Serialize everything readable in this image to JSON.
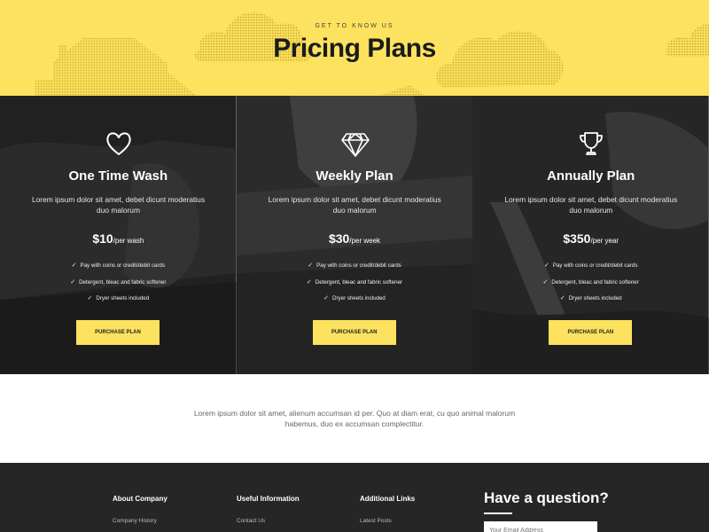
{
  "hero": {
    "eyebrow": "GET TO KNOW US",
    "title": "Pricing Plans",
    "bg_color": "#fce25e"
  },
  "plans": [
    {
      "icon": "heart-icon",
      "name": "One Time Wash",
      "description": "Lorem ipsum dolor sit amet, debet dicunt moderatius duo malorum",
      "price": "$10",
      "per": "/per wash",
      "features": [
        "Pay with coins or credit/debit cards",
        "Detergent, bleac and fabric softener",
        "Dryer sheets included"
      ],
      "cta": "PURCHASE PLAN"
    },
    {
      "icon": "diamond-icon",
      "name": "Weekly Plan",
      "description": "Lorem ipsum dolor sit amet, debet dicunt moderatius duo malorum",
      "price": "$30",
      "per": "/per week",
      "features": [
        "Pay with coins or credit/debit cards",
        "Detergent, bleac and fabric softener",
        "Dryer sheets included"
      ],
      "cta": "PURCHASE PLAN"
    },
    {
      "icon": "trophy-icon",
      "name": "Annually Plan",
      "description": "Lorem ipsum dolor sit amet, debet dicunt moderatius duo malorum",
      "price": "$350",
      "per": "/per year",
      "features": [
        "Pay with coins or credit/debit cards",
        "Detergent, bleac and fabric softener",
        "Dryer sheets included"
      ],
      "cta": "PURCHASE PLAN"
    }
  ],
  "note": "Lorem ipsum dolor sit amet, alienum accumsan id per. Quo at diam erat, cu quo animal malorum habemus, duo ex accumsan complectitur.",
  "footer": {
    "columns": [
      {
        "heading": "About Company",
        "links": [
          "Company History"
        ]
      },
      {
        "heading": "Useful Information",
        "links": [
          "Contact Us"
        ]
      },
      {
        "heading": "Additional Links",
        "links": [
          "Latest Posts"
        ]
      }
    ],
    "question_title": "Have a question?",
    "email_placeholder": "Your Email Address"
  }
}
